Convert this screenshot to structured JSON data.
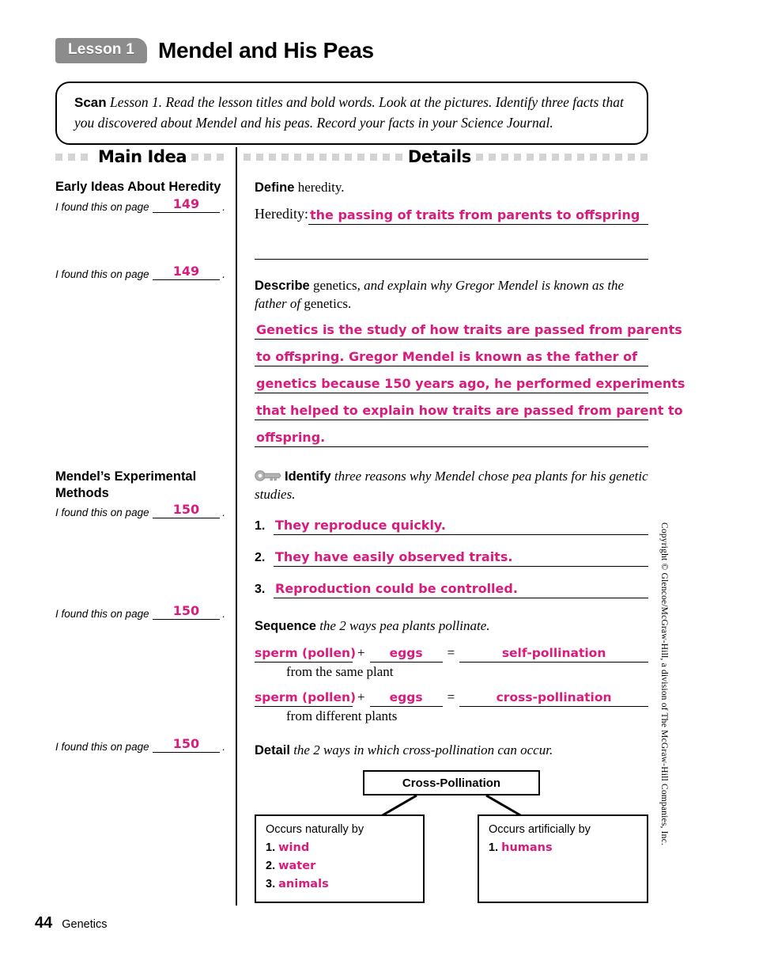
{
  "header": {
    "lesson_tag": "Lesson 1",
    "title": "Mendel and His Peas"
  },
  "scan_box": {
    "cue": "Scan",
    "text": "Lesson 1. Read the lesson titles and bold words. Look at the pictures. Identify three facts that you discovered about Mendel and his peas. Record your facts in your Science Journal."
  },
  "columns": {
    "main_idea_header": "Main Idea",
    "details_header": "Details"
  },
  "main_idea": {
    "found_prefix": "I found this on page",
    "found_suffix": ".",
    "blocks": [
      {
        "title": "Early Ideas About Heredity",
        "page": "149"
      },
      {
        "title": "",
        "page": "149"
      },
      {
        "title": "Mendel’s Experimental Methods",
        "page": "150"
      },
      {
        "title": "",
        "page": "150"
      },
      {
        "title": "",
        "page": "150"
      }
    ]
  },
  "details": {
    "define": {
      "cue": "Define",
      "prompt": " heredity.",
      "label": "Heredity:",
      "answer": "the passing of traits from parents to offspring",
      "blank_lines": 1
    },
    "describe": {
      "cue": "Describe",
      "prompt_plain": " genetics, ",
      "prompt_italic": "and explain why Gregor Mendel is known as the father of",
      "prompt_tail": " genetics.",
      "answer_lines": [
        "Genetics is the study of how traits are passed from parents",
        "to offspring. Gregor Mendel is known as the father of",
        "genetics because 150 years ago, he performed experiments",
        "that helped to explain how traits are passed from parent to",
        "offspring."
      ]
    },
    "identify": {
      "icon": "key-icon",
      "cue": "Identify",
      "prompt": " three reasons why Mendel chose pea plants for his genetic studies.",
      "items": [
        {
          "num": "1.",
          "answer": "They reproduce quickly."
        },
        {
          "num": "2.",
          "answer": "They have easily observed traits."
        },
        {
          "num": "3.",
          "answer": "Reproduction could be controlled."
        }
      ]
    },
    "sequence": {
      "cue": "Sequence",
      "prompt": " the 2 ways pea plants pollinate.",
      "equations": [
        {
          "left": "sperm (pollen)",
          "plus": "+",
          "middle": "eggs",
          "equals": "=",
          "right": "self-pollination",
          "sub": "from the same plant"
        },
        {
          "left": "sperm (pollen)",
          "plus": "+",
          "middle": "eggs",
          "equals": "=",
          "right": "cross-pollination",
          "sub": "from different plants"
        }
      ]
    },
    "detail": {
      "cue": "Detail",
      "prompt": " the 2 ways in which cross-pollination can occur.",
      "chart": {
        "top_box": "Cross-Pollination",
        "left_box": {
          "head": "Occurs naturally by",
          "items": [
            {
              "num": "1.",
              "answer": "wind"
            },
            {
              "num": "2.",
              "answer": "water"
            },
            {
              "num": "3.",
              "answer": "animals"
            }
          ]
        },
        "right_box": {
          "head": "Occurs artificially by",
          "items": [
            {
              "num": "1.",
              "answer": "humans"
            }
          ]
        }
      }
    }
  },
  "copyright": "Copyright © Glencoe/McGraw-Hill, a division of The McGraw-Hill Companies, Inc.",
  "footer": {
    "page_number": "44",
    "chapter": "Genetics"
  },
  "colors": {
    "answer_pink": "#d81b7d",
    "tag_gray": "#8c8c8c",
    "dash_gray": "#d3d3d3"
  }
}
